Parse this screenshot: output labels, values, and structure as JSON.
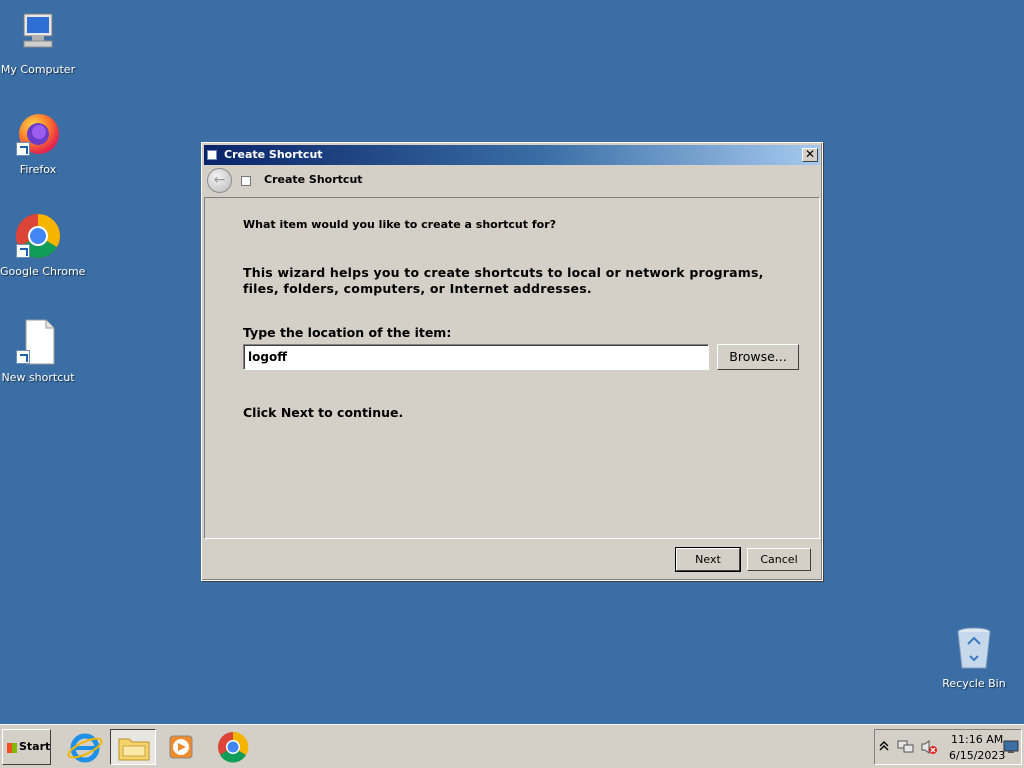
{
  "desktop": {
    "icons": [
      {
        "label": "My Computer"
      },
      {
        "label": "Firefox"
      },
      {
        "label": "Google Chrome"
      },
      {
        "label": "New shortcut"
      },
      {
        "label": "Recycle Bin"
      }
    ]
  },
  "dialog": {
    "title": "Create Shortcut",
    "close_glyph": "✕",
    "nav_title": "Create Shortcut",
    "back_glyph": "←",
    "heading": "What item would you like to create a shortcut for?",
    "description": "This wizard helps you to create shortcuts to local or network programs, files, folders, computers, or Internet addresses.",
    "location_label": "Type the location of the item:",
    "location_value": "logoff",
    "browse_label": "Browse...",
    "continue_text": "Click Next to continue.",
    "next_label": "Next",
    "cancel_label": "Cancel"
  },
  "taskbar": {
    "start_label": "Start",
    "items": [
      {
        "name": "internet-explorer-icon"
      },
      {
        "name": "file-explorer-icon",
        "active": true
      },
      {
        "name": "media-player-icon"
      },
      {
        "name": "chrome-icon"
      }
    ],
    "tray": {
      "time": "11:16 AM",
      "date": "6/15/2023",
      "icons": [
        "chevron-up-icon",
        "network-icon",
        "volume-muted-icon",
        "show-desktop-icon"
      ]
    }
  },
  "colors": {
    "desktop": "#3a6ea5",
    "window_face": "#d4d0c8",
    "title_start": "#0a246a",
    "title_end": "#a6caf0"
  }
}
